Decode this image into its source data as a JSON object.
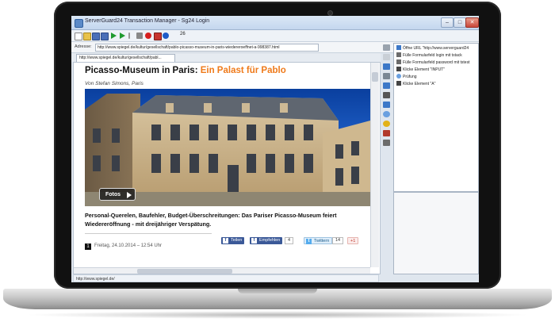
{
  "window": {
    "title": "ServerGuard24 Transaction Manager - Sg24 Login",
    "minimize": "–",
    "maximize": "□",
    "close": "✕"
  },
  "toolbar": {
    "zoom": "26",
    "icons": [
      "new-icon",
      "open-icon",
      "save-icon",
      "save-all-icon",
      "play-icon",
      "play-step-icon",
      "pause-icon",
      "stop-icon",
      "record-icon",
      "settings-icon",
      "info-icon"
    ]
  },
  "address": {
    "label": "Adresse:",
    "url": "http://www.spiegel.de/kultur/gesellschaft/pablo-picasso-museum-in-paris-wiedereroeffnet-a-998387.html"
  },
  "tab": {
    "label": "http://www.spiegel.de/kultur/gesellschaft/pabl..."
  },
  "article": {
    "title_main": "Picasso-Museum in Paris: ",
    "title_highlight": "Ein Palast für Pablo",
    "byline": "Von Stefan Simons, Paris",
    "photo_button": "Fotos",
    "teaser": "Personal-Querelen, Baufehler, Budget-Überschreitungen: Das Pariser Picasso-Museum feiert Wiedereröffnung - mit dreijähriger Verspätung.",
    "date_badge": "1",
    "date": "Freitag, 24.10.2014 – 12:54 Uhr"
  },
  "share": {
    "facebook": "Teilen",
    "recommend": "Empfehlen",
    "recommend_count": "4",
    "twitter": "Twittern",
    "twitter_count": "14",
    "gplus": "+1"
  },
  "statusbar": {
    "text": "http://www.spiegel.de/"
  },
  "transactions": [
    {
      "icon": "browser-icon",
      "label": "Öffne URL \"http://www.serverguard24"
    },
    {
      "icon": "fill-icon",
      "label": "Fülle Formularfeld login mit tstack"
    },
    {
      "icon": "fill-icon",
      "label": "Fülle Formularfeld password mit tstest"
    },
    {
      "icon": "click-icon",
      "label": "Klicke Element \"INPUT\""
    },
    {
      "icon": "check-icon",
      "label": "Prüfung"
    },
    {
      "icon": "click-icon",
      "label": "Klicke Element \"A\""
    }
  ],
  "colors": {
    "title_highlight": "#ef7a1a",
    "facebook": "#3b5998",
    "twitter": "#55acee",
    "gplus": "#dd4b39"
  }
}
